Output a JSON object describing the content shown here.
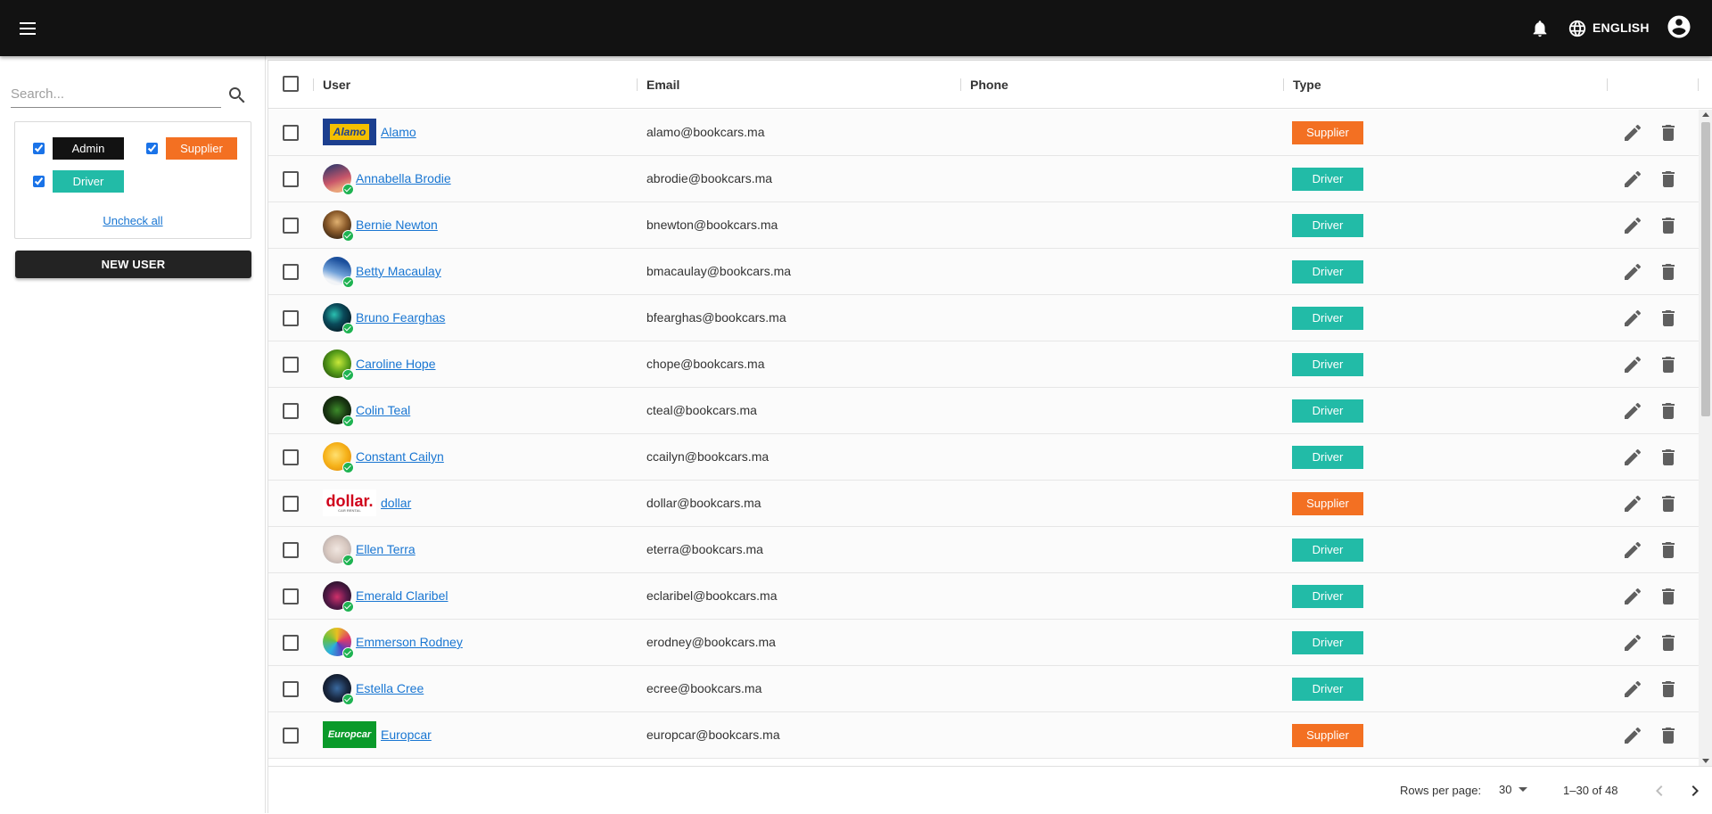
{
  "topbar": {
    "menu_icon": "hamburger-menu-icon",
    "notifications_icon": "bell-icon",
    "language_icon": "globe-icon",
    "language_label": "ENGLISH",
    "account_icon": "account-circle-icon"
  },
  "sidebar": {
    "search_placeholder": "Search...",
    "search_icon": "search-icon",
    "filters": [
      {
        "label": "Admin",
        "checked": true,
        "color": "#121212"
      },
      {
        "label": "Supplier",
        "checked": true,
        "color": "#f37022"
      },
      {
        "label": "Driver",
        "checked": true,
        "color": "#22bba7"
      }
    ],
    "uncheck_all_label": "Uncheck all",
    "new_user_label": "NEW USER"
  },
  "grid": {
    "columns": {
      "user": "User",
      "email": "Email",
      "phone": "Phone",
      "type": "Type"
    },
    "rows": [
      {
        "name": "Alamo",
        "email": "alamo@bookcars.ma",
        "phone": "",
        "type": "Supplier",
        "avatar": {
          "kind": "logo",
          "brand": "Alamo"
        }
      },
      {
        "name": "Annabella Brodie",
        "email": "abrodie@bookcars.ma",
        "phone": "",
        "type": "Driver",
        "avatar": {
          "kind": "photo",
          "bg": "linear-gradient(160deg,#3b3b6b 10%,#c9566a 55%,#e9a27a 80%)"
        }
      },
      {
        "name": "Bernie Newton",
        "email": "bnewton@bookcars.ma",
        "phone": "",
        "type": "Driver",
        "avatar": {
          "kind": "photo",
          "bg": "radial-gradient(circle at 50% 40%,#e0b070 0%,#8a5a2a 45%,#2a1c10 90%)"
        }
      },
      {
        "name": "Betty Macaulay",
        "email": "bmacaulay@bookcars.ma",
        "phone": "",
        "type": "Driver",
        "avatar": {
          "kind": "photo",
          "bg": "linear-gradient(200deg,#1b4f9c 20%,#6fa0d8 55%,#f2f4f7 80%)"
        }
      },
      {
        "name": "Bruno Fearghas",
        "email": "bfearghas@bookcars.ma",
        "phone": "",
        "type": "Driver",
        "avatar": {
          "kind": "photo",
          "bg": "radial-gradient(circle at 40% 40%,#2ac0b0 0%,#0a4a5a 40%,#04151e 85%)"
        }
      },
      {
        "name": "Caroline Hope",
        "email": "chope@bookcars.ma",
        "phone": "",
        "type": "Driver",
        "avatar": {
          "kind": "photo",
          "bg": "radial-gradient(circle at 55% 45%,#c8e83a 0%,#5aa01a 45%,#1e4a0a 90%)"
        }
      },
      {
        "name": "Colin Teal",
        "email": "cteal@bookcars.ma",
        "phone": "",
        "type": "Driver",
        "avatar": {
          "kind": "photo",
          "bg": "radial-gradient(circle at 50% 50%,#3c8a2a 0%,#1a3a12 50%,#0a1408 90%)"
        }
      },
      {
        "name": "Constant Cailyn",
        "email": "ccailyn@bookcars.ma",
        "phone": "",
        "type": "Driver",
        "avatar": {
          "kind": "photo",
          "bg": "radial-gradient(circle at 45% 45%,#ffe070 0%,#f6b21a 50%,#e08a0a 90%)"
        }
      },
      {
        "name": "dollar",
        "email": "dollar@bookcars.ma",
        "phone": "",
        "type": "Supplier",
        "avatar": {
          "kind": "logo",
          "brand": "dollar.",
          "sub": "CAR RENTAL"
        }
      },
      {
        "name": "Ellen Terra",
        "email": "eterra@bookcars.ma",
        "phone": "",
        "type": "Driver",
        "avatar": {
          "kind": "photo",
          "bg": "radial-gradient(circle at 50% 50%,#f0e6e0 0%,#d8c8c0 50%,#b0a8a8 90%)"
        }
      },
      {
        "name": "Emerald Claribel",
        "email": "eclaribel@bookcars.ma",
        "phone": "",
        "type": "Driver",
        "avatar": {
          "kind": "photo",
          "bg": "radial-gradient(circle at 50% 55%,#d0306a 0%,#5a1a4a 45%,#14101e 90%)"
        }
      },
      {
        "name": "Emmerson Rodney",
        "email": "erodney@bookcars.ma",
        "phone": "",
        "type": "Driver",
        "avatar": {
          "kind": "photo",
          "bg": "conic-gradient(#e8c020,#e03a6a,#5a3ac0,#2ab0e0,#6ac040,#e8c020)"
        }
      },
      {
        "name": "Estella Cree",
        "email": "ecree@bookcars.ma",
        "phone": "",
        "type": "Driver",
        "avatar": {
          "kind": "photo",
          "bg": "radial-gradient(circle at 50% 50%,#3a6aa0 0%,#1a2a44 50%,#0a0e18 90%)"
        }
      },
      {
        "name": "Europcar",
        "email": "europcar@bookcars.ma",
        "phone": "",
        "type": "Supplier",
        "avatar": {
          "kind": "logo",
          "brand": "Europcar"
        }
      }
    ],
    "row_actions": {
      "edit_icon": "pencil-icon",
      "delete_icon": "trash-icon"
    }
  },
  "pagination": {
    "rows_per_page_label": "Rows per page:",
    "rows_per_page_value": "30",
    "range_label": "1–30 of 48",
    "prev_icon": "chevron-left-icon",
    "next_icon": "chevron-right-icon"
  }
}
